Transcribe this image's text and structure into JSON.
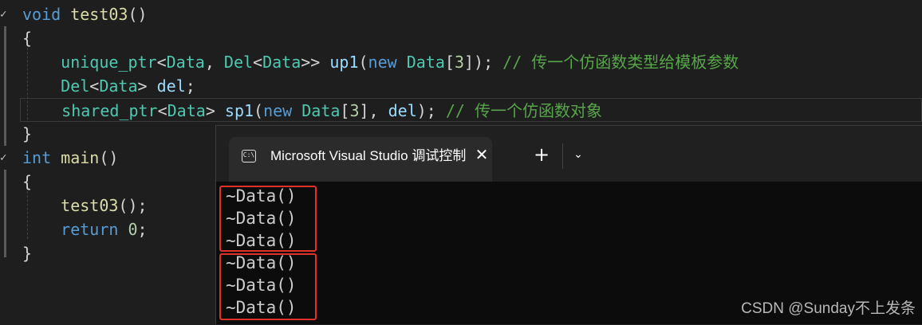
{
  "editor": {
    "lines": [
      {
        "tokens": [
          {
            "t": "void",
            "c": "kw"
          },
          {
            "t": " ",
            "c": "pl"
          },
          {
            "t": "test03",
            "c": "fn"
          },
          {
            "t": "()",
            "c": "pl"
          }
        ]
      },
      {
        "tokens": [
          {
            "t": "{",
            "c": "pl"
          }
        ]
      },
      {
        "tokens": [
          {
            "t": "    ",
            "c": "pl"
          },
          {
            "t": "unique_ptr",
            "c": "ty"
          },
          {
            "t": "<",
            "c": "pl"
          },
          {
            "t": "Data",
            "c": "ty"
          },
          {
            "t": ", ",
            "c": "pl"
          },
          {
            "t": "Del",
            "c": "ty"
          },
          {
            "t": "<",
            "c": "pl"
          },
          {
            "t": "Data",
            "c": "ty"
          },
          {
            "t": ">> ",
            "c": "pl"
          },
          {
            "t": "up1",
            "c": "id"
          },
          {
            "t": "(",
            "c": "pl"
          },
          {
            "t": "new",
            "c": "kw"
          },
          {
            "t": " ",
            "c": "pl"
          },
          {
            "t": "Data",
            "c": "ty"
          },
          {
            "t": "[",
            "c": "pl"
          },
          {
            "t": "3",
            "c": "nm"
          },
          {
            "t": "]); ",
            "c": "pl"
          },
          {
            "t": "// 传一个仿函数类型给模板参数",
            "c": "cm"
          }
        ]
      },
      {
        "tokens": [
          {
            "t": "    ",
            "c": "pl"
          },
          {
            "t": "Del",
            "c": "ty"
          },
          {
            "t": "<",
            "c": "pl"
          },
          {
            "t": "Data",
            "c": "ty"
          },
          {
            "t": "> ",
            "c": "pl"
          },
          {
            "t": "del",
            "c": "id"
          },
          {
            "t": ";",
            "c": "pl"
          }
        ]
      },
      {
        "tokens": [
          {
            "t": "    ",
            "c": "pl"
          },
          {
            "t": "shared_ptr",
            "c": "ty"
          },
          {
            "t": "<",
            "c": "pl"
          },
          {
            "t": "Data",
            "c": "ty"
          },
          {
            "t": "> ",
            "c": "pl"
          },
          {
            "t": "sp1",
            "c": "id"
          },
          {
            "t": "(",
            "c": "pl"
          },
          {
            "t": "new",
            "c": "kw"
          },
          {
            "t": " ",
            "c": "pl"
          },
          {
            "t": "Data",
            "c": "ty"
          },
          {
            "t": "[",
            "c": "pl"
          },
          {
            "t": "3",
            "c": "nm"
          },
          {
            "t": "], ",
            "c": "pl"
          },
          {
            "t": "del",
            "c": "id"
          },
          {
            "t": "); ",
            "c": "pl"
          },
          {
            "t": "// 传一个仿函数对象",
            "c": "cm"
          }
        ]
      },
      {
        "tokens": [
          {
            "t": "}",
            "c": "pl"
          }
        ]
      },
      {
        "tokens": [
          {
            "t": "int",
            "c": "kw"
          },
          {
            "t": " ",
            "c": "pl"
          },
          {
            "t": "main",
            "c": "fn"
          },
          {
            "t": "()",
            "c": "pl"
          }
        ]
      },
      {
        "tokens": [
          {
            "t": "{",
            "c": "pl"
          }
        ]
      },
      {
        "tokens": [
          {
            "t": "    ",
            "c": "pl"
          },
          {
            "t": "test03",
            "c": "fn"
          },
          {
            "t": "();",
            "c": "pl"
          }
        ]
      },
      {
        "tokens": [
          {
            "t": "    ",
            "c": "pl"
          },
          {
            "t": "return",
            "c": "kw"
          },
          {
            "t": " ",
            "c": "pl"
          },
          {
            "t": "0",
            "c": "nm"
          },
          {
            "t": ";",
            "c": "pl"
          }
        ]
      },
      {
        "tokens": [
          {
            "t": "}",
            "c": "pl"
          }
        ]
      }
    ],
    "fold_marks": [
      "✓",
      "✓"
    ]
  },
  "terminal": {
    "tab_icon": "C:\\",
    "tab_title": "Microsoft Visual Studio 调试控制台",
    "tab_close": "✕",
    "new_tab": "+",
    "dropdown": "⌄",
    "output": [
      "~Data()",
      "~Data()",
      "~Data()",
      "~Data()",
      "~Data()",
      "~Data()"
    ]
  },
  "watermark": "CSDN @Sunday不上发条",
  "colors": {
    "editor_bg": "#1e1e1e",
    "terminal_bg": "#0c0c0c",
    "highlight_box": "#e0312b",
    "keyword": "#569cd6",
    "type": "#4ec9b0",
    "function": "#dcdcaa",
    "comment": "#57a64a",
    "number": "#b5cea8",
    "identifier": "#9cdcfe"
  },
  "icons": [
    "console-icon",
    "close-icon",
    "plus-icon",
    "chevron-down-icon",
    "fold-check-icon"
  ]
}
